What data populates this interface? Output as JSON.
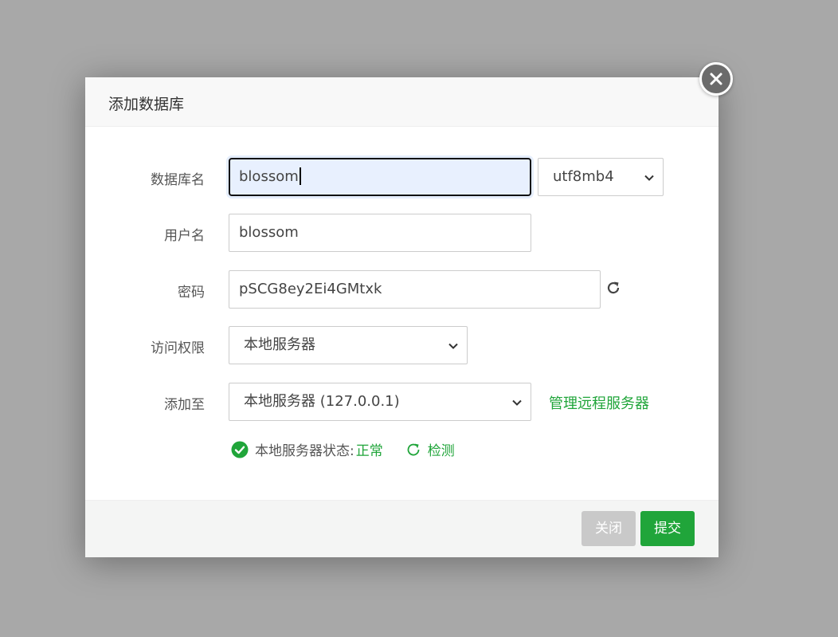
{
  "dialog": {
    "title": "添加数据库"
  },
  "form": {
    "db_name": {
      "label": "数据库名",
      "value": "blossom"
    },
    "charset": {
      "value": "utf8mb4"
    },
    "username": {
      "label": "用户名",
      "value": "blossom"
    },
    "password": {
      "label": "密码",
      "value": "pSCG8ey2Ei4GMtxk"
    },
    "access": {
      "label": "访问权限",
      "value": "本地服务器"
    },
    "add_to": {
      "label": "添加至",
      "value": "本地服务器 (127.0.0.1)",
      "manage_link": "管理远程服务器"
    },
    "status": {
      "text": "本地服务器状态:",
      "value": "正常",
      "detect_label": "检测"
    }
  },
  "footer": {
    "close_label": "关闭",
    "submit_label": "提交"
  },
  "colors": {
    "accent": "#20a53a",
    "focus_bg": "#e8f0fe",
    "backdrop": "#a8a8a8"
  },
  "icons": {
    "close": "close-icon",
    "refresh": "refresh-icon",
    "chevron": "chevron-down-icon",
    "ok": "check-circle-icon",
    "detect": "refresh-circle-icon"
  }
}
